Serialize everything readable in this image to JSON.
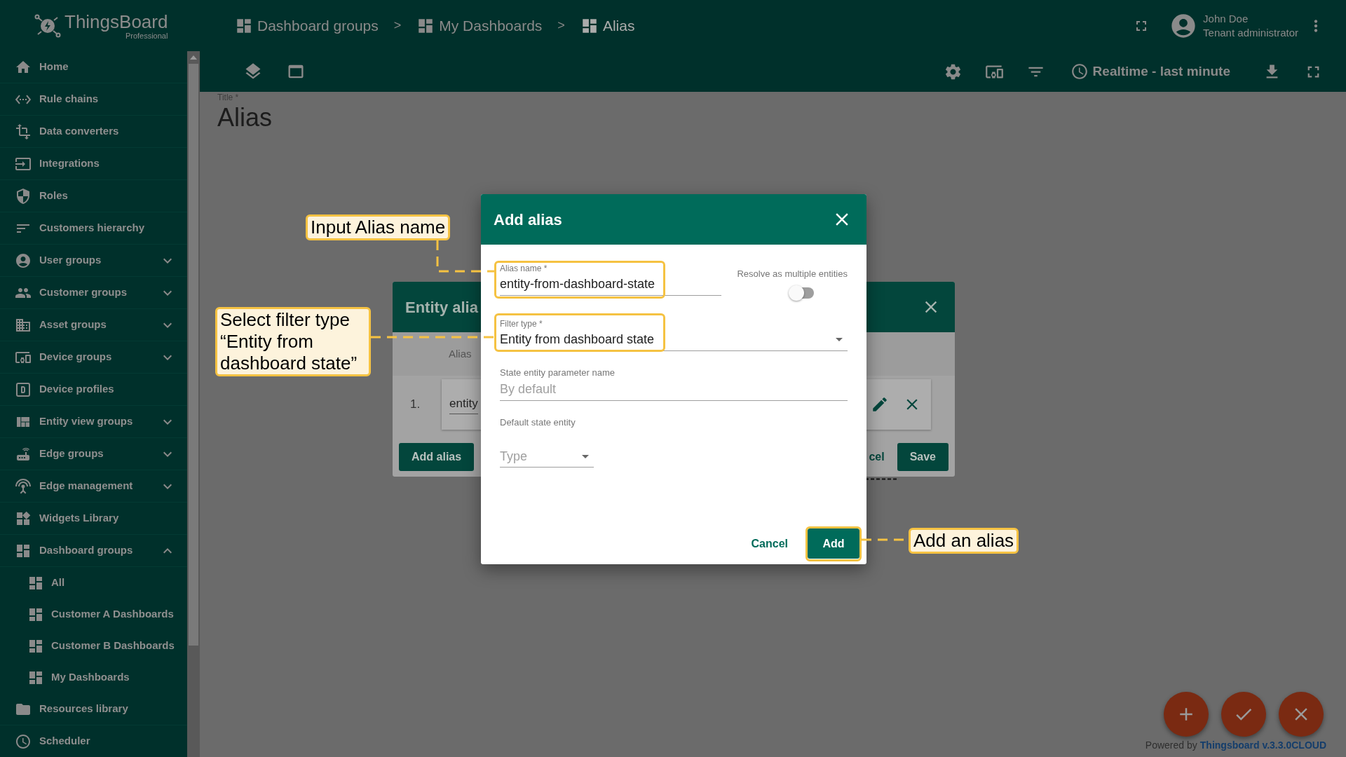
{
  "logo": {
    "name": "ThingsBoard",
    "edition": "Professional"
  },
  "breadcrumbs": [
    {
      "label": "Dashboard groups",
      "separator": ">",
      "selected": false
    },
    {
      "label": "My Dashboards",
      "separator": ">",
      "selected": false
    },
    {
      "label": "Alias",
      "selected": true
    }
  ],
  "user": {
    "name": "John Doe",
    "role": "Tenant administrator"
  },
  "toolbar": {
    "timewindow": "Realtime - last minute"
  },
  "sidebar": {
    "items": [
      {
        "label": "Home",
        "kind": "link"
      },
      {
        "label": "Rule chains",
        "kind": "link"
      },
      {
        "label": "Data converters",
        "kind": "link"
      },
      {
        "label": "Integrations",
        "kind": "link"
      },
      {
        "label": "Roles",
        "kind": "link"
      },
      {
        "label": "Customers hierarchy",
        "kind": "link"
      },
      {
        "label": "User groups",
        "kind": "group",
        "expanded": false
      },
      {
        "label": "Customer groups",
        "kind": "group",
        "expanded": false
      },
      {
        "label": "Asset groups",
        "kind": "group",
        "expanded": false
      },
      {
        "label": "Device groups",
        "kind": "group",
        "expanded": false
      },
      {
        "label": "Device profiles",
        "kind": "link"
      },
      {
        "label": "Entity view groups",
        "kind": "group",
        "expanded": false
      },
      {
        "label": "Edge groups",
        "kind": "group",
        "expanded": false
      },
      {
        "label": "Edge management",
        "kind": "group",
        "expanded": false
      },
      {
        "label": "Widgets Library",
        "kind": "link"
      },
      {
        "label": "Dashboard groups",
        "kind": "group",
        "expanded": true,
        "children": [
          {
            "label": "All"
          },
          {
            "label": "Customer A Dashboards"
          },
          {
            "label": "Customer B Dashboards"
          },
          {
            "label": "My Dashboards"
          }
        ]
      },
      {
        "label": "Resources library",
        "kind": "link"
      },
      {
        "label": "Scheduler",
        "kind": "link"
      }
    ]
  },
  "dashboard": {
    "title_label": "Title *",
    "title": "Alias"
  },
  "entity_aliases_dialog": {
    "title": "Entity alia",
    "column_header": "Alias",
    "rows": [
      {
        "number": "1.",
        "value": "entity"
      }
    ],
    "add_button": "Add alias",
    "cancel_button": "cel",
    "save_button": "Save"
  },
  "add_alias_dialog": {
    "title": "Add alias",
    "alias_name": {
      "label": "Alias name *",
      "value": "entity-from-dashboard-state"
    },
    "resolve_multiple": {
      "label": "Resolve as multiple entities",
      "on": false
    },
    "filter_type": {
      "label": "Filter type *",
      "value": "Entity from dashboard state"
    },
    "state_entity_parameter": {
      "label": "State entity parameter name",
      "placeholder": "By default"
    },
    "default_state_entity": {
      "label": "Default state entity",
      "placeholder": "Type"
    },
    "cancel_button": "Cancel",
    "add_button": "Add"
  },
  "annotations": [
    {
      "text": "Input Alias name"
    },
    {
      "text": "Select filter type “Entity from dashboard state”"
    },
    {
      "text": "Add an alias"
    }
  ],
  "footer": {
    "powered_by": "Powered by",
    "version_link": "Thingsboard v.3.3.0CLOUD"
  }
}
